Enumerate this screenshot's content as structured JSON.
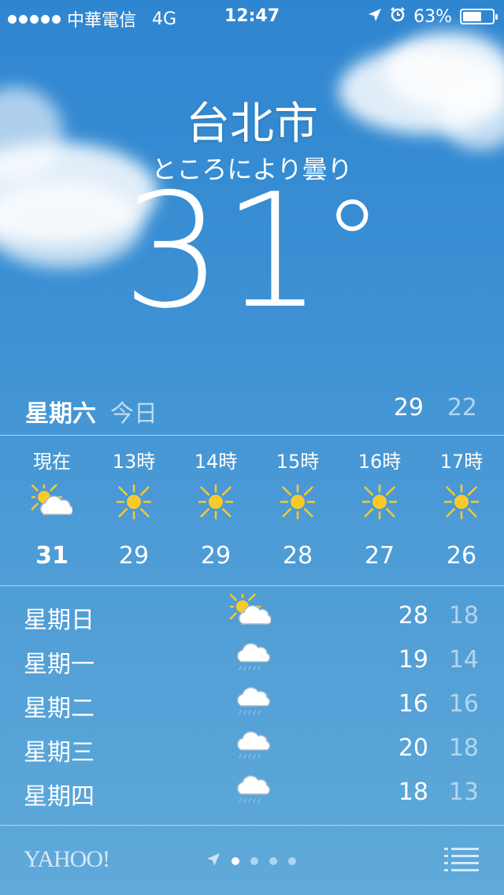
{
  "status_bar": {
    "carrier": "中華電信",
    "network": "4G",
    "time": "12:47",
    "battery": "63%",
    "battery_level": 0.63
  },
  "weather": {
    "city": "台北市",
    "condition": "ところにより曇り",
    "temperature": "31",
    "degree_symbol": "°"
  },
  "today": {
    "day": "星期六",
    "label": "今日",
    "high": "29",
    "low": "22"
  },
  "hourly": [
    {
      "time": "現在",
      "icon": "partly-cloudy-icon",
      "temp": "31"
    },
    {
      "time": "13時",
      "icon": "sun-icon",
      "temp": "29"
    },
    {
      "time": "14時",
      "icon": "sun-icon",
      "temp": "29"
    },
    {
      "time": "15時",
      "icon": "sun-icon",
      "temp": "28"
    },
    {
      "time": "16時",
      "icon": "sun-icon",
      "temp": "27"
    },
    {
      "time": "17時",
      "icon": "sun-icon",
      "temp": "26"
    }
  ],
  "daily": [
    {
      "day": "星期日",
      "icon": "partly-cloudy-icon",
      "high": "28",
      "low": "18"
    },
    {
      "day": "星期一",
      "icon": "rain-icon",
      "high": "19",
      "low": "14"
    },
    {
      "day": "星期二",
      "icon": "rain-icon",
      "high": "16",
      "low": "16"
    },
    {
      "day": "星期三",
      "icon": "rain-icon",
      "high": "20",
      "low": "18"
    },
    {
      "day": "星期四",
      "icon": "rain-icon",
      "high": "18",
      "low": "13"
    }
  ],
  "footer": {
    "provider": "YAHOO!",
    "page_count": 4,
    "active_page": 1
  },
  "colors": {
    "sun": "#f7c92b",
    "sun_outline": "#e8b019"
  }
}
